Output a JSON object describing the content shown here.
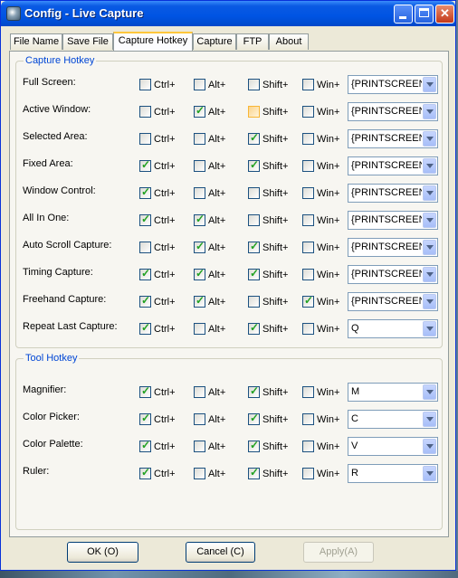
{
  "window": {
    "title": "Config - Live Capture"
  },
  "tabs": [
    {
      "label": "File Name"
    },
    {
      "label": "Save File"
    },
    {
      "label": "Capture Hotkey"
    },
    {
      "label": "Capture"
    },
    {
      "label": "FTP"
    },
    {
      "label": "About"
    }
  ],
  "capture_group": {
    "title": "Capture Hotkey",
    "rows": [
      {
        "label": "Full Screen:",
        "ctrl": false,
        "alt": false,
        "shift": false,
        "win": false,
        "key": "{PRINTSCREEN}"
      },
      {
        "label": "Active Window:",
        "ctrl": false,
        "alt": true,
        "shift": false,
        "win": false,
        "key": "{PRINTSCREEN}"
      },
      {
        "label": "Selected Area:",
        "ctrl": false,
        "alt": false,
        "shift": true,
        "win": false,
        "key": "{PRINTSCREEN}"
      },
      {
        "label": "Fixed Area:",
        "ctrl": true,
        "alt": false,
        "shift": true,
        "win": false,
        "key": "{PRINTSCREEN}"
      },
      {
        "label": "Window Control:",
        "ctrl": true,
        "alt": false,
        "shift": false,
        "win": false,
        "key": "{PRINTSCREEN}"
      },
      {
        "label": "All In One:",
        "ctrl": true,
        "alt": true,
        "shift": false,
        "win": false,
        "key": "{PRINTSCREEN}"
      },
      {
        "label": "Auto Scroll Capture:",
        "ctrl": false,
        "alt": true,
        "shift": true,
        "win": false,
        "key": "{PRINTSCREEN}"
      },
      {
        "label": "Timing Capture:",
        "ctrl": true,
        "alt": true,
        "shift": true,
        "win": false,
        "key": "{PRINTSCREEN}"
      },
      {
        "label": "Freehand Capture:",
        "ctrl": true,
        "alt": true,
        "shift": false,
        "win": true,
        "key": "{PRINTSCREEN}"
      },
      {
        "label": "Repeat Last Capture:",
        "ctrl": true,
        "alt": false,
        "shift": true,
        "win": false,
        "key": "Q"
      }
    ]
  },
  "tool_group": {
    "title": "Tool Hotkey",
    "rows": [
      {
        "label": "Magnifier:",
        "ctrl": true,
        "alt": false,
        "shift": true,
        "win": false,
        "key": "M"
      },
      {
        "label": "Color Picker:",
        "ctrl": true,
        "alt": false,
        "shift": true,
        "win": false,
        "key": "C"
      },
      {
        "label": "Color Palette:",
        "ctrl": true,
        "alt": false,
        "shift": true,
        "win": false,
        "key": "V"
      },
      {
        "label": "Ruler:",
        "ctrl": true,
        "alt": false,
        "shift": true,
        "win": false,
        "key": "R"
      }
    ]
  },
  "modifiers": {
    "ctrl": "Ctrl+",
    "alt": "Alt+",
    "shift": "Shift+",
    "win": "Win+"
  },
  "buttons": {
    "ok": "OK (O)",
    "cancel": "Cancel (C)",
    "apply": "Apply(A)"
  },
  "colors": {
    "group_title": "#0046d5",
    "check": "#21a121",
    "title_bar": "#0054e3"
  }
}
